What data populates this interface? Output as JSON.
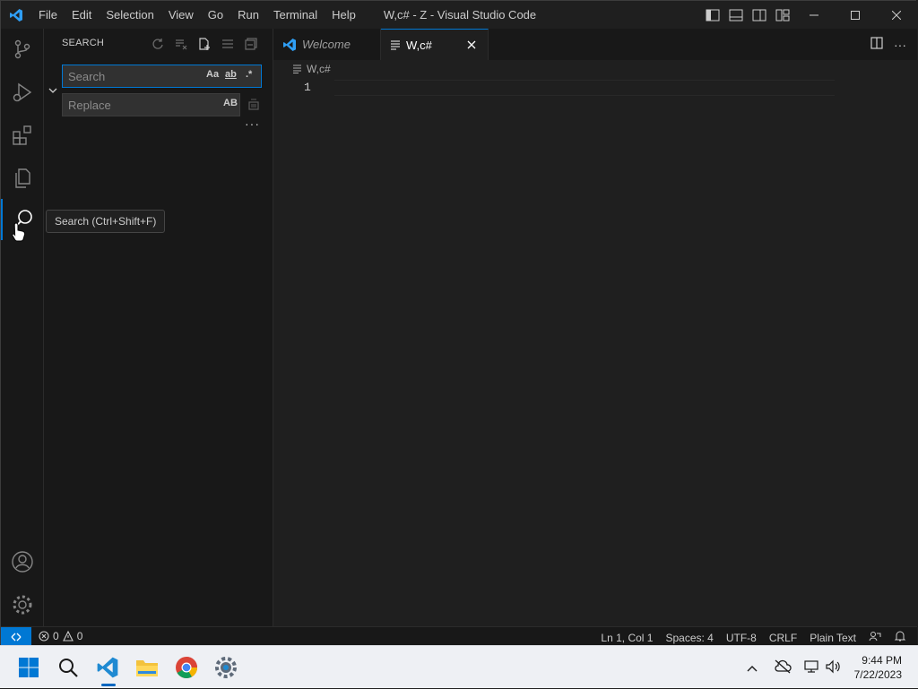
{
  "window": {
    "title": "W,c# - Z - Visual Studio Code",
    "menu": [
      "File",
      "Edit",
      "Selection",
      "View",
      "Go",
      "Run",
      "Terminal",
      "Help"
    ]
  },
  "activity_bar": {
    "items": [
      "source-control-icon",
      "run-debug-icon",
      "extensions-icon",
      "explorer-icon",
      "search-icon"
    ],
    "active": "search-icon",
    "bottom": [
      "accounts-icon",
      "manage-gear-icon"
    ]
  },
  "sidebar": {
    "header": "SEARCH",
    "search": {
      "placeholder": "Search",
      "value": "",
      "options": [
        "Aa",
        "ab",
        ".*"
      ]
    },
    "replace": {
      "placeholder": "Replace",
      "value": "",
      "option": "AB"
    },
    "more": "···"
  },
  "tooltip": "Search (Ctrl+Shift+F)",
  "tabs": [
    {
      "label": "Welcome",
      "active": false
    },
    {
      "label": "W,c#",
      "active": true
    }
  ],
  "editor": {
    "breadcrumb": "W,c#",
    "line_numbers": [
      "1"
    ]
  },
  "status_bar": {
    "errors": "0",
    "warnings": "0",
    "position": "Ln 1, Col 1",
    "spaces": "Spaces: 4",
    "encoding": "UTF-8",
    "eol": "CRLF",
    "language": "Plain Text"
  },
  "taskbar": {
    "apps": [
      "start-icon",
      "search-icon",
      "vscode-icon",
      "file-explorer-icon",
      "chrome-icon",
      "settings-icon"
    ],
    "time": "9:44 PM",
    "date": "7/22/2023"
  },
  "colors": {
    "accent": "#0078d4",
    "background": "#1f1f1f",
    "sidebar": "#181818"
  }
}
